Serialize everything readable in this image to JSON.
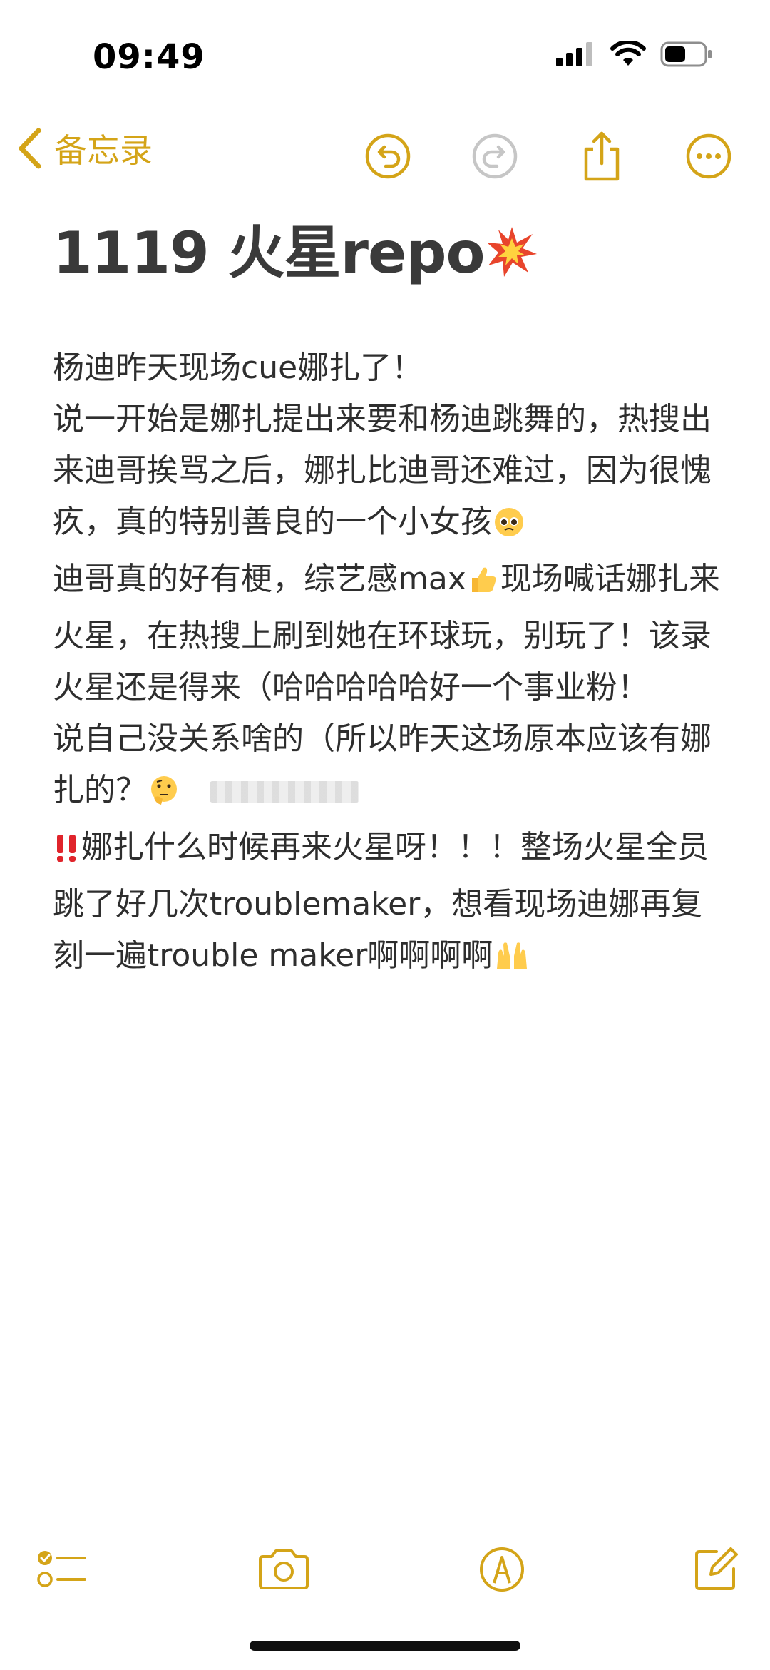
{
  "status_bar": {
    "time": "09:49"
  },
  "nav": {
    "back_label": "备忘录"
  },
  "note": {
    "title": "1119 火星repo",
    "title_emoji_icon": "collision-icon",
    "lines": [
      "杨迪昨天现场cue娜扎了！",
      "说一开始是娜扎提出来要和杨迪跳舞的，热搜出来迪哥挨骂之后，娜扎比迪哥还难过，因为很愧疚，真的特别善良的一个小女孩",
      "迪哥真的好有梗，综艺感max",
      "现场喊话娜扎来火星，在热搜上刷到她在环球玩，别玩了！该录火星还是得来（哈哈哈哈哈好一个事业粉！",
      "说自己没关系啥的（所以昨天这场原本应该有娜扎的？",
      "娜扎什么时候再来火星呀！！！整场火星全员跳了好几次troublemaker，想看现场迪娜再复刻一遍trouble maker啊啊啊啊"
    ]
  },
  "colors": {
    "accent": "#d4a418",
    "text": "#2e2e2e"
  }
}
